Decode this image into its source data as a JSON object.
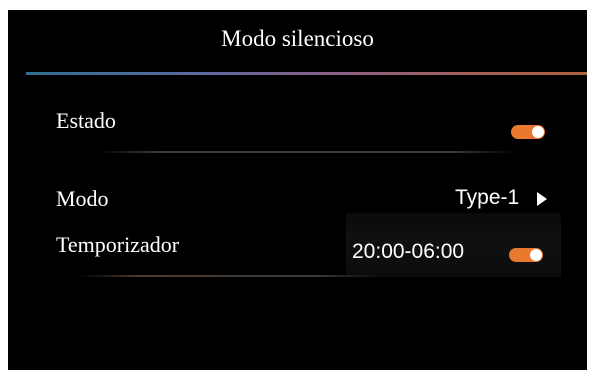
{
  "screen": {
    "title": "Modo silencioso",
    "accent_color": "#e8792e",
    "rows": [
      {
        "label": "Estado",
        "control": "toggle",
        "state": "on"
      },
      {
        "label": "Modo",
        "value": "Type-1",
        "icon": "chevron-right-icon"
      },
      {
        "label": "Temporizador",
        "value": "20:00-06:00",
        "control": "toggle",
        "state": "on"
      }
    ]
  }
}
